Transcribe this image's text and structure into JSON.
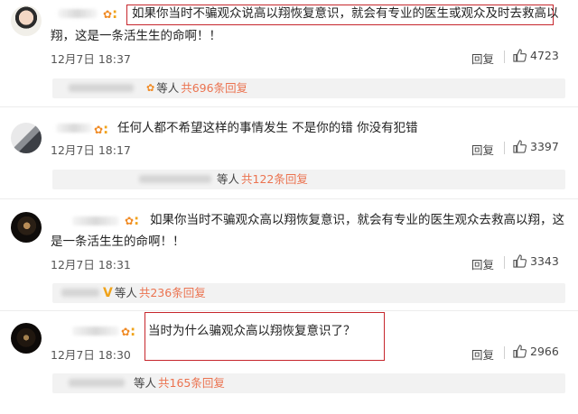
{
  "comments": [
    {
      "text": "如果你当时不骗观众说高以翔恢复意识，就会有专业的医生或观众及时去救高以翔，这是一条活生生的命啊！！",
      "line1": "如果你当时不骗观众说高以翔恢复意识，就会有专业的医生或观众及时去救高以",
      "line2": "翔，这是一条活生生的命啊！！",
      "time": "12月7日 18:37",
      "reply_label": "回复",
      "likes": "4723",
      "sub_prefix": "等人",
      "sub_count": "共696条回复"
    },
    {
      "text": "任何人都不希望这样的事情发生 不是你的错 你没有犯错",
      "time": "12月7日 18:17",
      "reply_label": "回复",
      "likes": "3397",
      "sub_prefix": "等人",
      "sub_count": "共122条回复"
    },
    {
      "text": "如果你当时不骗观众高以翔恢复意识，就会有专业的医生观众去救高以翔，这是一条活生生的命啊！！",
      "line1": "如果你当时不骗观众高以翔恢复意识，就会有专业的医生观众去救高以翔，这",
      "line2": "是一条活生生的命啊！！",
      "time": "12月7日 18:31",
      "reply_label": "回复",
      "likes": "3343",
      "sub_prefix": "等人",
      "sub_count": "共236条回复"
    },
    {
      "text": "当时为什么骗观众高以翔恢复意识了？",
      "time": "12月7日 18:30",
      "reply_label": "回复",
      "likes": "2966",
      "sub_prefix": "等人",
      "sub_count": "共165条回复"
    }
  ],
  "colors": {
    "highlight_box": "#c6262c",
    "reply_count": "#eb7350",
    "medal": "#f08a24"
  },
  "icons": [
    "thumbs-up-icon",
    "medal-icon",
    "v-badge-icon"
  ]
}
